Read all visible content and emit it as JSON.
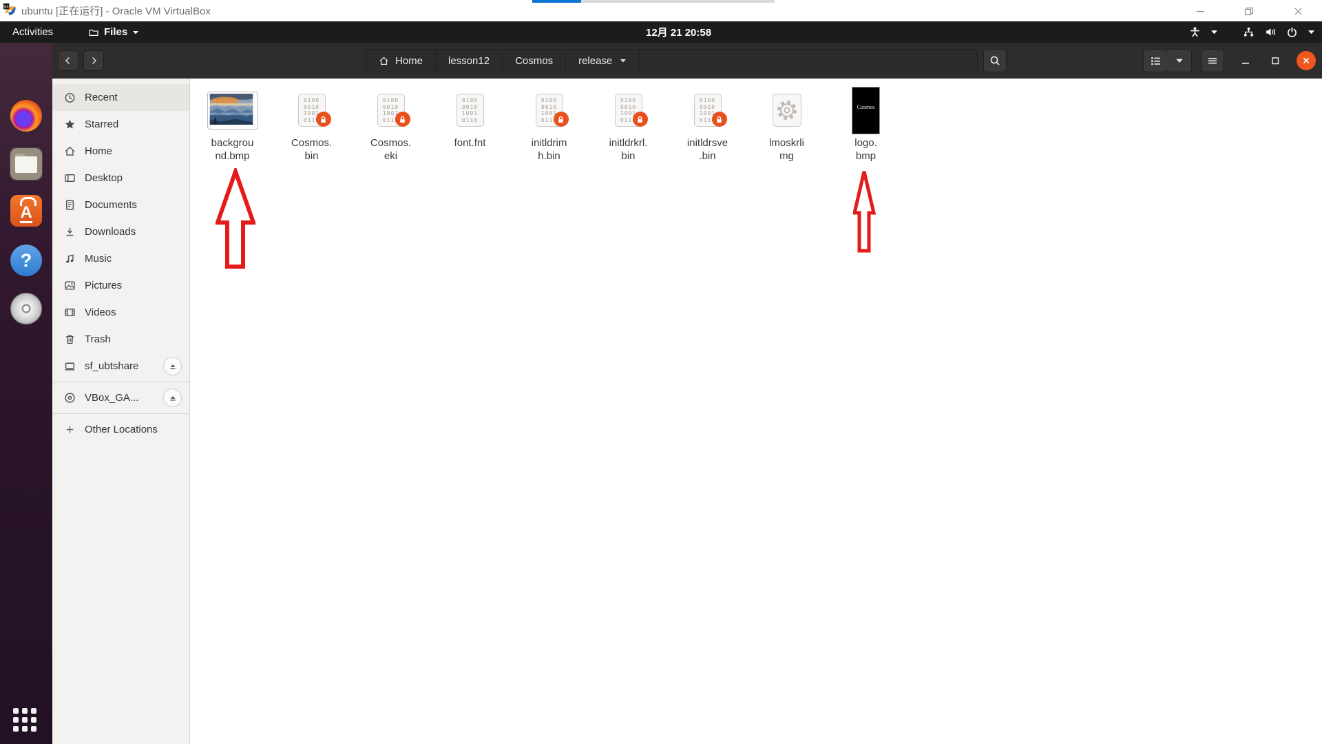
{
  "host_window": {
    "title": "ubuntu [正在运行] - Oracle VM VirtualBox"
  },
  "topbar": {
    "activities": "Activities",
    "app_menu": "Files",
    "clock": "12月 21 20:58",
    "status_icons": [
      "accessibility-icon",
      "dropdown-caret",
      "network-icon",
      "volume-icon",
      "power-icon",
      "dropdown-caret"
    ]
  },
  "dock": {
    "icons": [
      "firefox",
      "files",
      "ubuntu-software",
      "help",
      "disc",
      "show-applications"
    ],
    "active": "files"
  },
  "toolbar": {
    "breadcrumbs": [
      "Home",
      "lesson12",
      "Cosmos",
      "release"
    ],
    "buttons": [
      "back",
      "forward",
      "search",
      "list-view",
      "view-options",
      "menu",
      "minimize",
      "restore",
      "close"
    ]
  },
  "sidebar": {
    "items": [
      {
        "label": "Recent",
        "selected": true
      },
      {
        "label": "Starred"
      },
      {
        "label": "Home"
      },
      {
        "label": "Desktop"
      },
      {
        "label": "Documents"
      },
      {
        "label": "Downloads"
      },
      {
        "label": "Music"
      },
      {
        "label": "Pictures"
      },
      {
        "label": "Videos"
      },
      {
        "label": "Trash"
      },
      {
        "label": "sf_ubtshare",
        "eject": true
      },
      {
        "label": "VBox_GA...",
        "eject": true
      },
      {
        "label": "Other Locations"
      }
    ]
  },
  "files": [
    {
      "name": "background.bmp",
      "label_lines": [
        "backgrou",
        "nd.bmp"
      ],
      "icon": "image-thumbnail",
      "locked": false
    },
    {
      "name": "Cosmos.bin",
      "label_lines": [
        "Cosmos.",
        "bin"
      ],
      "icon": "binary",
      "locked": true
    },
    {
      "name": "Cosmos.eki",
      "label_lines": [
        "Cosmos.",
        "eki"
      ],
      "icon": "binary",
      "locked": true
    },
    {
      "name": "font.fnt",
      "label_lines": [
        "font.fnt"
      ],
      "icon": "binary",
      "locked": false
    },
    {
      "name": "initldrimh.bin",
      "label_lines": [
        "initldrim",
        "h.bin"
      ],
      "icon": "binary",
      "locked": true
    },
    {
      "name": "initldrkrl.bin",
      "label_lines": [
        "initldrkrl.",
        "bin"
      ],
      "icon": "binary",
      "locked": true
    },
    {
      "name": "initldrsve.bin",
      "label_lines": [
        "initldrsve",
        ".bin"
      ],
      "icon": "binary",
      "locked": true
    },
    {
      "name": "lmoskrlimg",
      "label_lines": [
        "lmoskrli",
        "mg"
      ],
      "icon": "executable-gear",
      "locked": false
    },
    {
      "name": "logo.bmp",
      "label_lines": [
        "logo.",
        "bmp"
      ],
      "icon": "logo-thumbnail",
      "locked": false
    }
  ],
  "binary_icon_digits": "0100\n0010\n1001\n0110",
  "logo_thumbnail_text": "Cosmos",
  "colors": {
    "ubuntu_orange": "#e95420",
    "lock_badge": "#e8511d",
    "arrow_red": "#e51a1a",
    "progress_blue": "#0b77d4",
    "topbar_bg": "#1c1c1c",
    "toolbar_bg": "#2e2c2c",
    "sidebar_bg": "#f3f2f1"
  }
}
